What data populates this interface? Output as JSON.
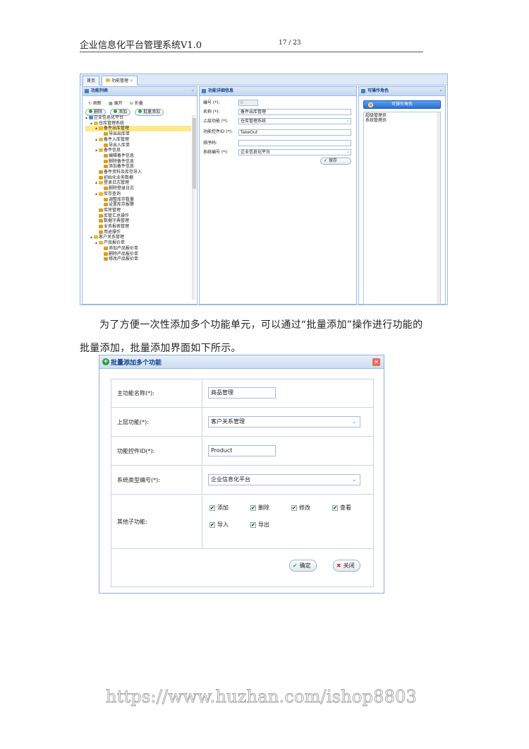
{
  "header": {
    "doc_title": "企业信息化平台管理系统V1.0",
    "page_no": "17 / 23"
  },
  "shot1": {
    "tabs": [
      {
        "label": "首页"
      },
      {
        "label": "功能管理"
      }
    ],
    "tab_close": "×",
    "left_panel": {
      "title": "功能列表",
      "collapse": "«",
      "tools": [
        {
          "glyph": "↻",
          "label": "刷新"
        },
        {
          "glyph": "▦",
          "label": "展开"
        },
        {
          "glyph": "⊟",
          "label": "折叠"
        }
      ],
      "buttons": [
        {
          "label": "删除"
        },
        {
          "label": "添加"
        },
        {
          "label": "批量添加"
        }
      ],
      "tree": [
        {
          "label": "企业信息化平台",
          "level": 0,
          "type": "root"
        },
        {
          "label": "仓库管理系统",
          "level": 1,
          "type": "folder"
        },
        {
          "label": "备件出库管理",
          "level": 2,
          "type": "folder",
          "selected": true
        },
        {
          "label": "导出出库单",
          "level": 3,
          "type": "key"
        },
        {
          "label": "备件入库管理",
          "level": 2,
          "type": "folder"
        },
        {
          "label": "导出入库单",
          "level": 3,
          "type": "key"
        },
        {
          "label": "备件信息",
          "level": 2,
          "type": "folder"
        },
        {
          "label": "编辑备件信息",
          "level": 3,
          "type": "key"
        },
        {
          "label": "删除备件信息",
          "level": 3,
          "type": "key"
        },
        {
          "label": "添加备件信息",
          "level": 3,
          "type": "key"
        },
        {
          "label": "备件资料及库存导入",
          "level": 2,
          "type": "key"
        },
        {
          "label": "初始化业务数据",
          "level": 2,
          "type": "key"
        },
        {
          "label": "登录日志管理",
          "level": 2,
          "type": "folder"
        },
        {
          "label": "删除登录日志",
          "level": 3,
          "type": "key"
        },
        {
          "label": "库存查询",
          "level": 2,
          "type": "folder"
        },
        {
          "label": "调整库存数量",
          "level": 3,
          "type": "key"
        },
        {
          "label": "设置库存报警",
          "level": 3,
          "type": "key"
        },
        {
          "label": "库房管理",
          "level": 2,
          "type": "key"
        },
        {
          "label": "库管汇总操作",
          "level": 2,
          "type": "key"
        },
        {
          "label": "数据字典管理",
          "level": 2,
          "type": "key"
        },
        {
          "label": "业务报表管理",
          "level": 2,
          "type": "key"
        },
        {
          "label": "用途操作",
          "level": 2,
          "type": "key"
        },
        {
          "label": "客户关系管理",
          "level": 1,
          "type": "folder"
        },
        {
          "label": "产品报价单",
          "level": 2,
          "type": "folder"
        },
        {
          "label": "添加产品报价单",
          "level": 3,
          "type": "key"
        },
        {
          "label": "删除产品报价单",
          "level": 3,
          "type": "key"
        },
        {
          "label": "修改产品报价单",
          "level": 3,
          "type": "key"
        }
      ]
    },
    "mid_panel": {
      "title": "功能详细信息",
      "collapse": "«",
      "fields": [
        {
          "label": "编号 (*):",
          "value": "0"
        },
        {
          "label": "名称 (*):",
          "value": "备件出库管理"
        },
        {
          "label": "上层功能 (*):",
          "value": "仓库管理系统"
        },
        {
          "label": "功能控件ID (*):",
          "value": "TakeOut"
        },
        {
          "label": "排序码:",
          "value": ""
        },
        {
          "label": "系统编号 (*):",
          "value": "企业信息化平台"
        }
      ],
      "save_label": "保存"
    },
    "right_panel": {
      "title": "可操作角色",
      "collapse": "»",
      "button_label": "可操作角色",
      "roles": [
        "超级管理员",
        "系统管理员"
      ]
    }
  },
  "paragraph": {
    "line1": "为了方便一次性添加多个功能单元，可以通过“批量添加”操作进行功能的",
    "line2": "批量添加，批量添加界面如下所示。"
  },
  "dialog": {
    "title": "批量添加多个功能",
    "close_glyph": "✕",
    "rows": {
      "main_name": {
        "label": "主功能名称(*):",
        "value": "商品管理"
      },
      "parent": {
        "label": "上层功能(*):",
        "value": "客户关系管理"
      },
      "control_id": {
        "label": "功能控件ID(*):",
        "value": "Product"
      },
      "system_type": {
        "label": "系统类型编号(*):",
        "value": "企业信息化平台"
      },
      "sub_functions": {
        "label": "其他子功能:"
      }
    },
    "checkboxes": [
      {
        "label": "添加",
        "checked": true
      },
      {
        "label": "删除",
        "checked": true
      },
      {
        "label": "修改",
        "checked": true
      },
      {
        "label": "查看",
        "checked": true
      },
      {
        "label": "导入",
        "checked": true
      },
      {
        "label": "导出",
        "checked": true
      }
    ],
    "check_glyph": "✔",
    "ok_label": "确定",
    "close_label": "关闭"
  },
  "watermark": "https://www.huzhan.com/ishop8803"
}
